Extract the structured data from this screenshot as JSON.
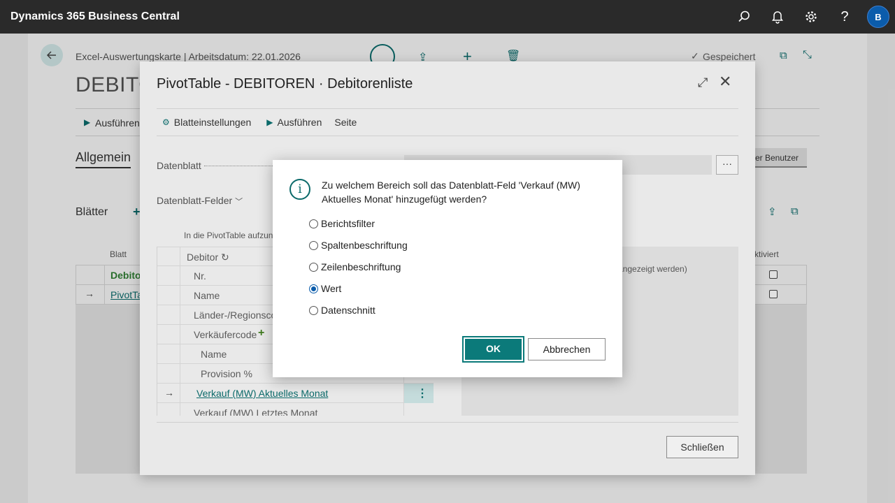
{
  "appbar": {
    "brand": "Dynamics 365 Business Central",
    "avatar_initial": "B"
  },
  "background": {
    "caption": "Excel-Auswertungskarte | Arbeitsdatum: 22.01.2026",
    "title": "DEBITO",
    "saved": "Gespeichert",
    "run": "Ausführen",
    "general_tab": "Allgemein",
    "user_button": "er Benutzer",
    "sheets": "Blätter",
    "col_sheet": "Blatt",
    "col_activated": "ktiviert",
    "rows": [
      "Debito",
      "PivotTa"
    ]
  },
  "pivot_dialog": {
    "title": "PivotTable - DEBITOREN · Debitorenliste",
    "toolbar": {
      "sheet_settings": "Blatteinstellungen",
      "run": "Ausführen",
      "page": "Seite"
    },
    "datasheet_label": "Datenblatt",
    "datasheet_fields_label": "Datenblatt-Felder",
    "ellipsis": "···",
    "include_label": "In die PivotTable aufzunc",
    "fields": [
      {
        "label": "Debitor ↻"
      },
      {
        "label": "Nr."
      },
      {
        "label": "Name"
      },
      {
        "label": "Länder-/Regionsco"
      },
      {
        "label": "Verkäufercode"
      },
      {
        "label": "Name"
      },
      {
        "label": "Provision %"
      },
      {
        "label": "Verkauf (MW) Aktuelles Monat"
      },
      {
        "label": "Verkauf (MW) Letztes Monat"
      }
    ],
    "right_panel_text": "angezeigt werden)",
    "close_button": "Schließen"
  },
  "confirm_dialog": {
    "question": "Zu welchem Bereich soll das Datenblatt-Feld 'Verkauf (MW) Aktuelles Monat' hinzugefügt werden?",
    "options": [
      "Berichtsfilter",
      "Spaltenbeschriftung",
      "Zeilenbeschriftung",
      "Wert",
      "Datenschnitt"
    ],
    "selected": "Wert",
    "ok": "OK",
    "cancel": "Abbrechen"
  },
  "colors": {
    "appbar": "#2a2a2a",
    "accent": "#0b7a7a",
    "avatar": "#0b5cab"
  }
}
